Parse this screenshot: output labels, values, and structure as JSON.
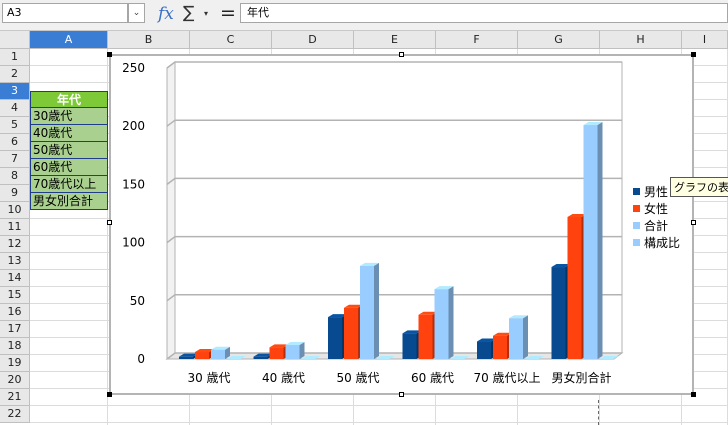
{
  "toolbar": {
    "name_box": "A3",
    "fx_symbol": "fx",
    "sigma_symbol": "∑",
    "sigma_dropdown": "▾",
    "equals_symbol": "=",
    "formula_content": "年代"
  },
  "columns": [
    "A",
    "B",
    "C",
    "D",
    "E",
    "F",
    "G",
    "H",
    "I"
  ],
  "selected_column": "A",
  "rows": [
    "1",
    "2",
    "3",
    "4",
    "5",
    "6",
    "7",
    "8",
    "9",
    "10",
    "11",
    "12",
    "13",
    "14",
    "15",
    "16",
    "17",
    "18",
    "19",
    "20",
    "21",
    "22"
  ],
  "selected_row": "3",
  "cells": {
    "a3": "年代",
    "a4": "30歳代",
    "a5": "40歳代",
    "a6": "50歳代",
    "a7": "60歳代",
    "a8": "70歳代以上",
    "a9": "男女別合計"
  },
  "tooltip": "グラフの表面",
  "colors": {
    "male": "#084a8f",
    "female": "#ff420e",
    "total": "#99ccff",
    "ratio": "#99ccff",
    "header_fill": "#7ec937",
    "cell_fill": "#a9d08e",
    "selection": "#3a7dd4"
  },
  "chart_data": {
    "type": "bar",
    "three_d": true,
    "categories": [
      "30 歳代",
      "40 歳代",
      "50 歳代",
      "60 歳代",
      "70 歳代以上",
      "男女別合計"
    ],
    "series": [
      {
        "name": "男性",
        "values": [
          2,
          2,
          36,
          22,
          15,
          79
        ]
      },
      {
        "name": "女性",
        "values": [
          6,
          10,
          44,
          38,
          20,
          122
        ]
      },
      {
        "name": "合計",
        "values": [
          8,
          12,
          80,
          60,
          35,
          201
        ]
      },
      {
        "name": "構成比",
        "values": [
          0,
          0,
          0,
          0,
          0,
          0
        ]
      }
    ],
    "ylim": [
      0,
      250
    ],
    "yticks": [
      "0",
      "50",
      "100",
      "150",
      "200",
      "250"
    ],
    "grid": true,
    "legend_position": "right"
  }
}
